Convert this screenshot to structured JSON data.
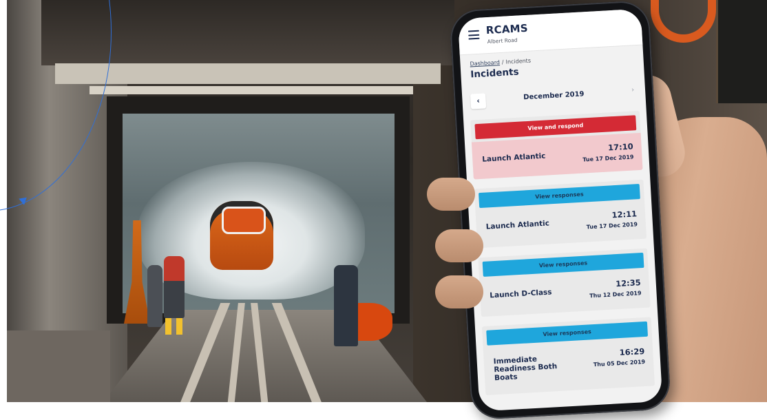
{
  "app": {
    "title": "RCAMS",
    "subtitle": "Albert Road"
  },
  "breadcrumb": {
    "dashboard": "Dashboard",
    "separator": "/",
    "current": "Incidents"
  },
  "page": {
    "title": "Incidents"
  },
  "month_nav": {
    "prev": "‹",
    "label": "December 2019",
    "next": "›"
  },
  "incidents": [
    {
      "action": "View and respond",
      "name": "Launch Atlantic",
      "time": "17:10",
      "date": "Tue 17 Dec 2019"
    },
    {
      "action": "View responses",
      "name": "Launch Atlantic",
      "time": "12:11",
      "date": "Tue 17 Dec 2019"
    },
    {
      "action": "View responses",
      "name": "Launch D-Class",
      "time": "12:35",
      "date": "Thu 12 Dec 2019"
    },
    {
      "action": "View responses",
      "name": "Immediate Readiness Both Boats",
      "time": "16:29",
      "date": "Thu 05 Dec 2019"
    }
  ],
  "colors": {
    "brand_navy": "#1b2a4e",
    "alert_red": "#d42a35",
    "info_blue": "#1fa6dc",
    "highlight_pink": "#f2c9cd",
    "annotation_blue": "#2f6fd8"
  },
  "icons": {
    "menu": "hamburger-menu-icon",
    "prev": "chevron-left-icon",
    "next": "chevron-right-icon"
  }
}
